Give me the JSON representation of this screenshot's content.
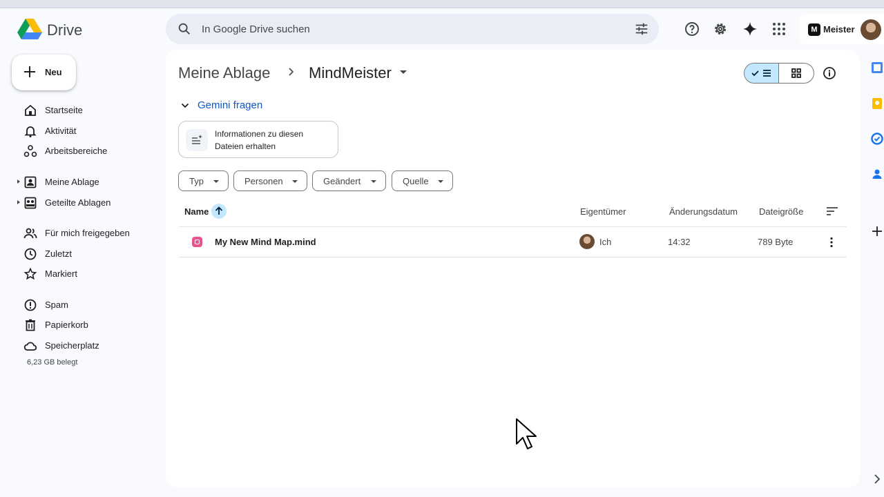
{
  "app": {
    "name": "Drive"
  },
  "search": {
    "placeholder": "In Google Drive suchen"
  },
  "account": {
    "org_name": "Meister",
    "org_logo_letter": "M"
  },
  "new_button": {
    "label": "Neu"
  },
  "nav": {
    "items": [
      {
        "label": "Startseite",
        "icon": "home-icon"
      },
      {
        "label": "Aktivität",
        "icon": "bell-icon"
      },
      {
        "label": "Arbeitsbereiche",
        "icon": "workspaces-icon"
      },
      {
        "label": "Meine Ablage",
        "icon": "my-drive-icon",
        "expandable": true
      },
      {
        "label": "Geteilte Ablagen",
        "icon": "shared-drives-icon",
        "expandable": true
      },
      {
        "label": "Für mich freigegeben",
        "icon": "people-icon"
      },
      {
        "label": "Zuletzt",
        "icon": "clock-icon"
      },
      {
        "label": "Markiert",
        "icon": "star-icon"
      },
      {
        "label": "Spam",
        "icon": "spam-icon"
      },
      {
        "label": "Papierkorb",
        "icon": "trash-icon"
      },
      {
        "label": "Speicherplatz",
        "icon": "cloud-icon"
      }
    ],
    "storage_used": "6,23 GB belegt"
  },
  "breadcrumb": {
    "root": "Meine Ablage",
    "current": "MindMeister"
  },
  "gemini": {
    "toggle_label": "Gemini fragen",
    "suggestion": "Informationen zu diesen Dateien erhalten"
  },
  "filters": [
    "Typ",
    "Personen",
    "Geändert",
    "Quelle"
  ],
  "table": {
    "columns": {
      "name": "Name",
      "owner": "Eigentümer",
      "modified": "Änderungsdatum",
      "size": "Dateigröße"
    },
    "rows": [
      {
        "name": "My New Mind Map.mind",
        "owner": "Ich",
        "modified": "14:32",
        "size": "789 Byte"
      }
    ]
  },
  "colors": {
    "accent": "#0b57d0",
    "selected": "#c2e7ff",
    "file_icon": "#e8548e"
  }
}
